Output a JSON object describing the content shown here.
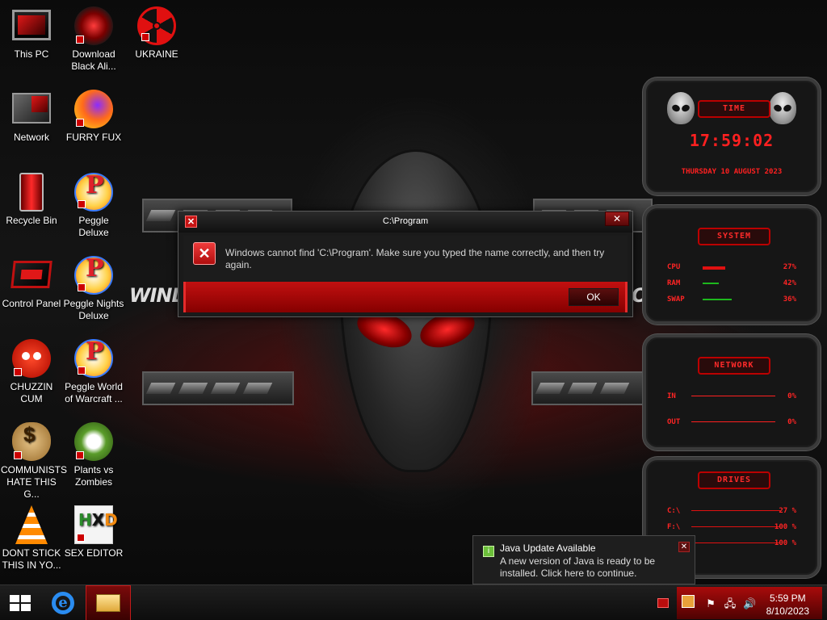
{
  "desktop_icons": [
    {
      "label": "This PC",
      "icon": "computer-icon"
    },
    {
      "label": "Download Black Ali...",
      "icon": "alien-disc-icon"
    },
    {
      "label": "UKRAINE",
      "icon": "radiation-icon"
    },
    {
      "label": "Network",
      "icon": "network-icon"
    },
    {
      "label": "FURRY FUX",
      "icon": "firefox-icon"
    },
    {
      "label": "Recycle Bin",
      "icon": "recycle-bin-icon"
    },
    {
      "label": "Peggle Deluxe",
      "icon": "peggle-icon"
    },
    {
      "label": "Control Panel",
      "icon": "control-panel-icon"
    },
    {
      "label": "Peggle Nights Deluxe",
      "icon": "peggle-icon"
    },
    {
      "label": "CHUZZIN CUM",
      "icon": "chuzzle-icon"
    },
    {
      "label": "Peggle World of Warcraft ...",
      "icon": "peggle-icon"
    },
    {
      "label": "COMMUNISTS HATE THIS G...",
      "icon": "money-bag-icon"
    },
    {
      "label": "Plants vs Zombies",
      "icon": "plants-icon"
    },
    {
      "label": "DONT STICK THIS IN YO...",
      "icon": "vlc-cone-icon"
    },
    {
      "label": "SEX EDITOR",
      "icon": "hxd-icon"
    }
  ],
  "wallpaper": {
    "text_left": "WINDOV",
    "text_right": "O"
  },
  "dialog": {
    "title": "C:\\Program",
    "message": "Windows cannot find 'C:\\Program'. Make sure you typed the name correctly, and then try again.",
    "ok_label": "OK",
    "close_glyph": "✕",
    "app_glyph": "✕",
    "error_glyph": "✕"
  },
  "gadget": {
    "time": {
      "heading": "TIME",
      "clock": "17:59:02",
      "date": "THURSDAY 10 AUGUST 2023"
    },
    "system": {
      "heading": "SYSTEM",
      "rows": [
        {
          "label": "CPU",
          "value": "27%",
          "level": 0.27
        },
        {
          "label": "RAM",
          "value": "42%",
          "level": 0.42
        },
        {
          "label": "SWAP",
          "value": "36%",
          "level": 0.36
        }
      ]
    },
    "network": {
      "heading": "NETWORK",
      "rows": [
        {
          "label": "IN",
          "value": "0%"
        },
        {
          "label": "OUT",
          "value": "0%"
        }
      ]
    },
    "drives": {
      "heading": "DRIVES",
      "rows": [
        {
          "label": "C:\\",
          "value": "27 %",
          "level": 0.27
        },
        {
          "label": "F:\\",
          "value": "100 %",
          "level": 1.0
        },
        {
          "label": "",
          "value": "100 %",
          "level": 1.0
        }
      ]
    }
  },
  "toast": {
    "title": "Java Update Available",
    "body": "A new version of Java is ready to be installed. Click here to continue.",
    "close_glyph": "✕"
  },
  "taskbar": {
    "clock_time": "5:59 PM",
    "clock_date": "8/10/2023",
    "pinned": [
      "start-icon",
      "internet-explorer-icon",
      "file-explorer-icon"
    ],
    "tray_glyphs": {
      "flag": "⚑",
      "network": "🖧",
      "volume": "🔊",
      "show_hidden": "▲"
    }
  },
  "colors": {
    "accent": "#c40f0f",
    "text": "#ffffff",
    "gadget_red": "#ff2424"
  }
}
